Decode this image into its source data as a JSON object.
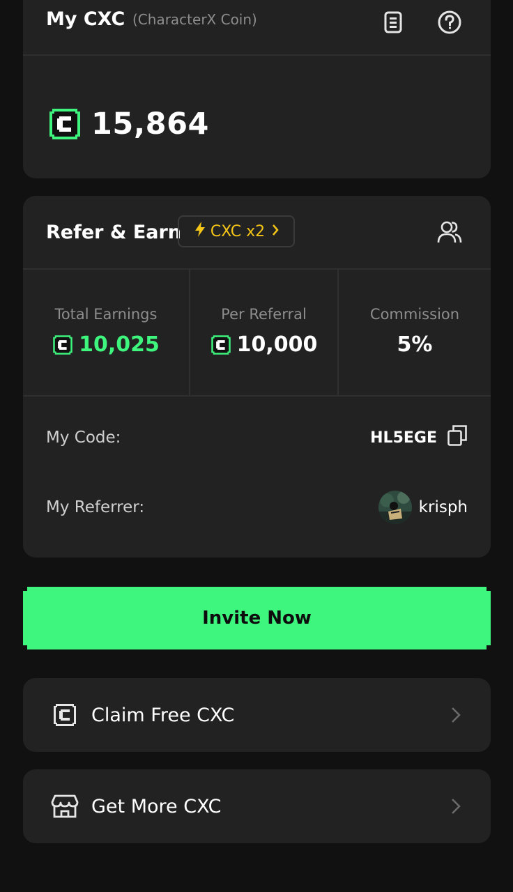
{
  "balance_card": {
    "title": "My CXC",
    "subtitle": "(CharacterX Coin)",
    "icons": [
      "document-icon",
      "help-icon"
    ],
    "coin_icon": "cxc-coin-icon",
    "balance": "15,864"
  },
  "refer_card": {
    "title": "Refer & Earn",
    "boost_label": "CXC x2",
    "boost_color": "#f5c518",
    "people_icon": "users-icon",
    "stats": [
      {
        "label": "Total Earnings",
        "value": "10,025",
        "has_coin": true,
        "color": "#3ef57e"
      },
      {
        "label": "Per Referral",
        "value": "10,000",
        "has_coin": true,
        "color": "#ffffff"
      },
      {
        "label": "Commission",
        "value": "5%",
        "has_coin": false,
        "color": "#ffffff"
      }
    ],
    "code_label": "My Code:",
    "code_value": "HL5EGE",
    "referrer_label": "My Referrer:",
    "referrer_name": "krisph"
  },
  "invite_button": {
    "label": "Invite Now",
    "color": "#3ef57e"
  },
  "menu": [
    {
      "label": "Claim Free CXC",
      "icon": "coin-outline-icon"
    },
    {
      "label": "Get More CXC",
      "icon": "store-icon"
    }
  ],
  "colors": {
    "background": "#111111",
    "card": "#222222",
    "accent_green": "#3ef57e"
  }
}
